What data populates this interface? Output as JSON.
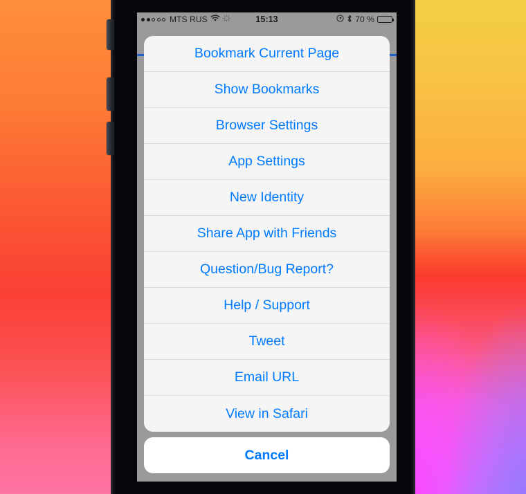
{
  "statusbar": {
    "signal_dots_total": 5,
    "signal_dots_filled": 2,
    "carrier": "MTS RUS",
    "wifi_icon": "wifi-icon",
    "activity_icon": "activity-spinner-icon",
    "time": "15:13",
    "location_icon": "location-arrow-icon",
    "bluetooth_icon": "bluetooth-icon",
    "battery_percent": "70 %",
    "battery_level": 70
  },
  "action_sheet": {
    "items": [
      {
        "label": "Bookmark Current Page"
      },
      {
        "label": "Show Bookmarks"
      },
      {
        "label": "Browser Settings"
      },
      {
        "label": "App Settings"
      },
      {
        "label": "New Identity"
      },
      {
        "label": "Share App with Friends"
      },
      {
        "label": "Question/Bug Report?"
      },
      {
        "label": "Help / Support"
      },
      {
        "label": "Tweet"
      },
      {
        "label": "Email URL"
      },
      {
        "label": "View in Safari"
      }
    ],
    "cancel_label": "Cancel",
    "accent_color": "#007aff"
  }
}
